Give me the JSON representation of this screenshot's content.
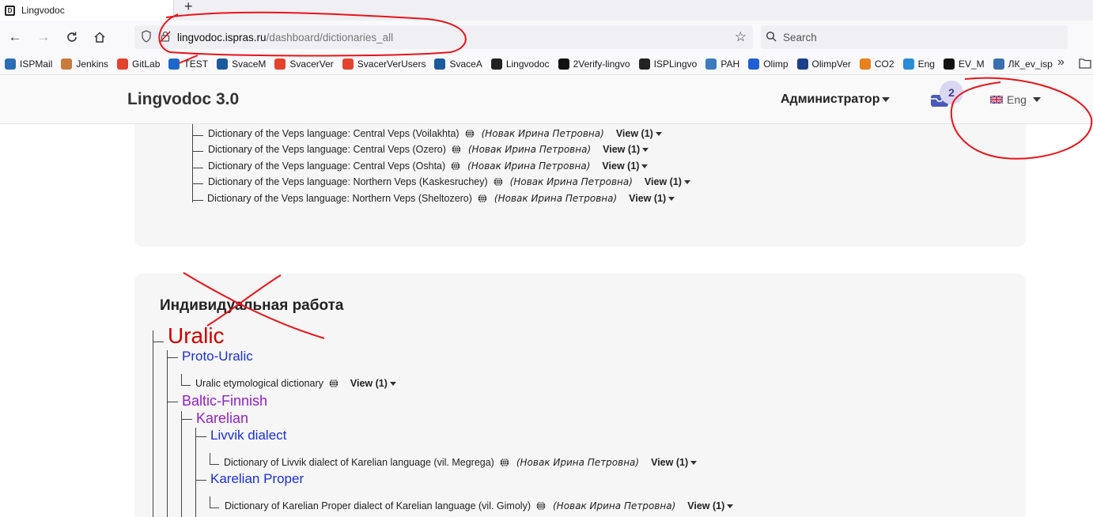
{
  "browser": {
    "tab_title": "Lingvodoc",
    "new_tab": "+",
    "url_host": "lingvodoc.ispras.ru",
    "url_path": "/dashboard/dictionaries_all",
    "search_placeholder": "Search",
    "bookmarks": [
      {
        "label": "ISPMail",
        "color": "#2a6fb5"
      },
      {
        "label": "Jenkins",
        "color": "#c97c3a"
      },
      {
        "label": "GitLab",
        "color": "#e2432a"
      },
      {
        "label": "TEST",
        "color": "#1d69c9"
      },
      {
        "label": "SvaceM",
        "color": "#1c5a9e"
      },
      {
        "label": "SvacerVer",
        "color": "#e2432a"
      },
      {
        "label": "SvacerVerUsers",
        "color": "#e2432a"
      },
      {
        "label": "SvaceA",
        "color": "#1c5a9e"
      },
      {
        "label": "Lingvodoc",
        "color": "#222222"
      },
      {
        "label": "2Verify-lingvo",
        "color": "#111111"
      },
      {
        "label": "ISPLingvo",
        "color": "#222222"
      },
      {
        "label": "РАН",
        "color": "#3c7bbf"
      },
      {
        "label": "Olimp",
        "color": "#1f5fd1"
      },
      {
        "label": "OlimpVer",
        "color": "#1b3f8a"
      },
      {
        "label": "CO2",
        "color": "#e8801d"
      },
      {
        "label": "Eng",
        "color": "#2a8bd6"
      },
      {
        "label": "EV_M",
        "color": "#111111"
      },
      {
        "label": "ЛК_ev_isp",
        "color": "#3a6fb0"
      }
    ],
    "overflow": "»"
  },
  "app": {
    "brand": "Lingvodoc 3.0",
    "user": "Администратор",
    "notifications": "2",
    "language": "Eng"
  },
  "veps_dictionaries": [
    {
      "title": "Dictionary of the Veps language: Central Veps (Voilakhta)",
      "author": "(Новак Ирина Петровна)",
      "view": "View (1)"
    },
    {
      "title": "Dictionary of the Veps language: Central Veps (Ozero)",
      "author": "(Новак Ирина Петровна)",
      "view": "View (1)"
    },
    {
      "title": "Dictionary of the Veps language: Central Veps (Oshta)",
      "author": "(Новак Ирина Петровна)",
      "view": "View (1)"
    },
    {
      "title": "Dictionary of the Veps language: Northern Veps (Kaskesruchey)",
      "author": "(Новак Ирина Петровна)",
      "view": "View (1)"
    },
    {
      "title": "Dictionary of the Veps language: Northern Veps (Sheltozero)",
      "author": "(Новак Ирина Петровна)",
      "view": "View (1)"
    }
  ],
  "individual": {
    "title": "Индивидуальная работа",
    "root_group": "Uralic",
    "proto_uralic": "Proto-Uralic",
    "uralic_dict": {
      "title": "Uralic etymological dictionary",
      "view": "View (1)"
    },
    "baltic_finnish": "Baltic-Finnish",
    "karelian": "Karelian",
    "livvik": "Livvik dialect",
    "livvik_dict": {
      "title": "Dictionary of Livvik dialect of Karelian language (vil. Megrega)",
      "author": "(Новак Ирина Петровна)",
      "view": "View (1)"
    },
    "karelian_proper": "Karelian Proper",
    "karelian_proper_dict": {
      "title": "Dictionary of Karelian Proper dialect of Karelian language (vil. Gimoly)",
      "author": "(Новак Ирина Петровна)",
      "view": "View (1)"
    }
  },
  "colors": {
    "annotation": "#e8141a",
    "group_red": "#cc0000",
    "group_blue": "#1b2fd6",
    "group_purple": "#9321c9"
  }
}
